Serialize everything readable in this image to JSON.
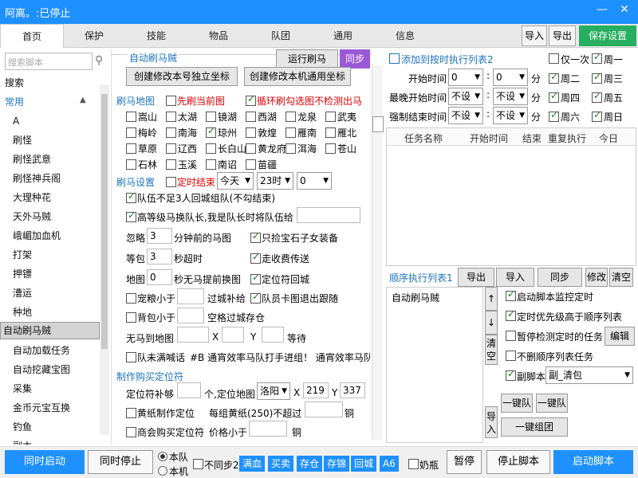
{
  "window": {
    "title": "阿离。:已停止",
    "minimize": "—",
    "close": "✕"
  },
  "tabs": [
    "首页",
    "保护",
    "技能",
    "物品",
    "队团",
    "通用",
    "信息"
  ],
  "toolbar": {
    "import": "导入",
    "export": "导出",
    "save": "保存设置"
  },
  "sidebar": {
    "search_placeholder": "搜索脚本",
    "items": [
      "搜索",
      "常用",
      "A",
      "刷怪",
      "刷怪武意",
      "刷怪神兵阁",
      "大理种花",
      "天外马贼",
      "峨嵋加血机",
      "打架",
      "押镖",
      "漕运",
      "种地",
      "自动刷马贼",
      "自动加载任务",
      "自动挖藏宝图",
      "采集",
      "金币元宝互换",
      "钓鱼",
      "副本"
    ],
    "selected": "自动刷马贼",
    "group_collapse_icon": "chevron-up-icon"
  },
  "mid": {
    "section_title": "自动刷马贼",
    "run_button": "运行刷马",
    "sync_button": "同步",
    "create_own_coord": "创建修改本号独立坐标",
    "create_machine_coord": "创建修改本机通用坐标",
    "map_section": "刷马地图",
    "refresh_current": "先刷当前图",
    "loop_no_detect": "循环刷勾选图不检测出马",
    "maps": [
      {
        "name": "嵩山",
        "checked": false
      },
      {
        "name": "太湖",
        "checked": false
      },
      {
        "name": "镜湖",
        "checked": false
      },
      {
        "name": "西湖",
        "checked": false
      },
      {
        "name": "龙泉",
        "checked": false
      },
      {
        "name": "武夷",
        "checked": false
      },
      {
        "name": "梅岭",
        "checked": false
      },
      {
        "name": "南海",
        "checked": false
      },
      {
        "name": "琼州",
        "checked": true
      },
      {
        "name": "敦煌",
        "checked": false
      },
      {
        "name": "雁南",
        "checked": false
      },
      {
        "name": "雁北",
        "checked": false
      },
      {
        "name": "草原",
        "checked": false
      },
      {
        "name": "辽西",
        "checked": false
      },
      {
        "name": "长白山",
        "checked": false
      },
      {
        "name": "黄龙府",
        "checked": false
      },
      {
        "name": "洱海",
        "checked": false
      },
      {
        "name": "苍山",
        "checked": false
      },
      {
        "name": "石林",
        "checked": false
      },
      {
        "name": "玉溪",
        "checked": false
      },
      {
        "name": "南诏",
        "checked": false
      },
      {
        "name": "苗疆",
        "checked": false
      }
    ],
    "settings_section": "刷马设置",
    "timed_end": "定时结束",
    "day_select": "今天",
    "hour_select": "23时",
    "minute_select": "0",
    "team_return": "队伍不足3人回城组队(不勾结束)",
    "high_level_switch": "高等级马换队长,我是队长时将队伍给",
    "ignore_label": "忽略",
    "ignore_value": "3",
    "ignore_suffix": "分钟前的马图",
    "pick_stone": "只捡宝石子女装备",
    "wait_label": "等包",
    "wait_value": "3",
    "wait_suffix": "秒超时",
    "toll_transport": "走收费传送",
    "map_label": "地图",
    "map_value": "0",
    "map_suffix": "秒无马提前换图",
    "locate_return": "定位符回城",
    "food_label": "宠粮小于",
    "food_suffix": "过城补给",
    "member_stuck": "队员卡图退出跟随",
    "bag_label": "背包小于",
    "bag_suffix": "空格过城存仓",
    "nohorse_label": "无马到地图",
    "x_label": "X",
    "y_label": "Y",
    "wait_text": "等待",
    "team_shout": "队未满喊话",
    "team_shout_text": "#B 通宵效率马队打手进组！ 通宵效率马队打",
    "locator_section": "制作购买定位符",
    "locator_supply": "定位符补够",
    "locator_supply_suffix": "个,定位地图",
    "locator_map": "洛阳",
    "locator_x": "219",
    "locator_y": "337",
    "yellow_paper": "黄纸制作定位",
    "yellow_limit": "每组黄纸(250)不超过",
    "yellow_unit": "铜",
    "shop_buy": "商会购买定位符",
    "shop_price": "价格小于",
    "shop_unit": "铜"
  },
  "right": {
    "add_timed_list": "添加到按时执行列表2",
    "once_only": "仅一次",
    "weekdays": [
      {
        "name": "周一",
        "checked": true
      },
      {
        "name": "周二",
        "checked": true
      },
      {
        "name": "周三",
        "checked": true
      },
      {
        "name": "周四",
        "checked": true
      },
      {
        "name": "周五",
        "checked": true
      },
      {
        "name": "周六",
        "checked": true
      },
      {
        "name": "周日",
        "checked": true
      }
    ],
    "start_time": "开始时间",
    "start_h": "0",
    "start_m": "0",
    "latest_start": "最晚开始时间",
    "latest_h": "不设",
    "latest_m": "不设",
    "force_end": "强制结束时间",
    "force_h": "不设",
    "force_m": "不设",
    "minute_unit": "分",
    "table_headers": [
      "任务名称",
      "开始时间",
      "结束",
      "重复执行",
      "今日"
    ],
    "seq_list": "顺序执行列表1",
    "seq_export": "导出",
    "seq_import": "导入",
    "seq_sync": "同步",
    "seq_modify": "修改",
    "seq_clear": "清空",
    "seq_items": [
      "自动刷马贼"
    ],
    "up_icon": "↑",
    "down_icon": "↓",
    "clear_side": "清空",
    "import_side": "导入",
    "start_monitor": "启动脚本监控定时",
    "timed_priority": "定时优先级高于顺序列表",
    "pause_detect": "暂停检测定时的任务",
    "edit": "编辑",
    "no_delete": "不删顺序列表任务",
    "sub_script": "副脚本",
    "sub_script_value": "副_清包",
    "one_key_team": "一键队",
    "one_key_team2": "一键队",
    "one_key_group": "一键组团"
  },
  "bottom": {
    "sync_start": "同时启动",
    "sync_stop": "同时停止",
    "this_team": "本队",
    "this_machine": "本机",
    "not_sync2": "不同步2",
    "chips": [
      "满血",
      "买卖",
      "存仓",
      "存锦",
      "回城",
      "A6"
    ],
    "milk": "奶瓶",
    "pause": "暂停",
    "stop_script": "停止脚本",
    "start_script": "启动脚本"
  }
}
